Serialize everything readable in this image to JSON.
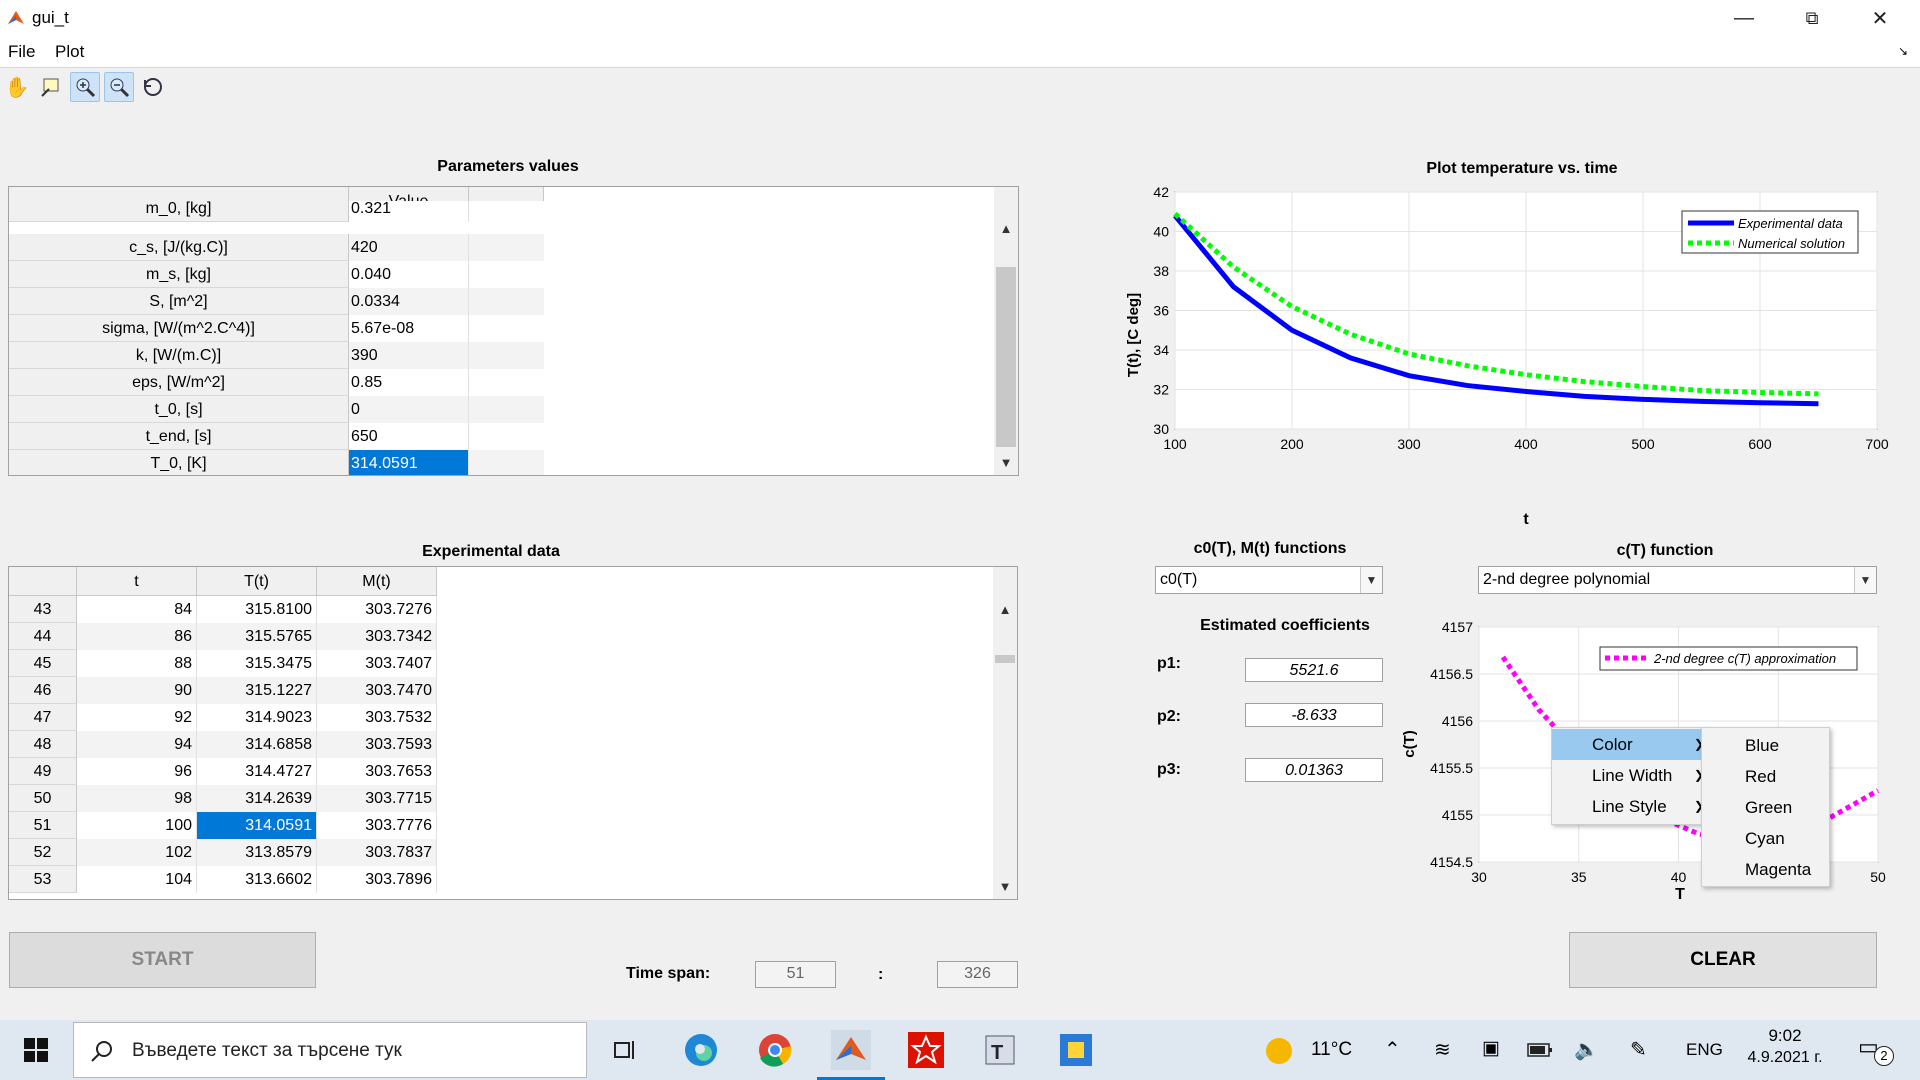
{
  "window": {
    "title": "gui_t"
  },
  "menu": [
    "File",
    "Plot"
  ],
  "params_panel": {
    "title": "Parameters values",
    "col_header": "Value",
    "rows": [
      {
        "label": "m_0, [kg]",
        "value": "0.321"
      },
      {
        "label": "c_s, [J/(kg.C)]",
        "value": "420"
      },
      {
        "label": "m_s, [kg]",
        "value": "0.040"
      },
      {
        "label": "S, [m^2]",
        "value": "0.0334"
      },
      {
        "label": "sigma, [W/(m^2.C^4)]",
        "value": "5.67e-08"
      },
      {
        "label": "k, [W/(m.C)]",
        "value": "390"
      },
      {
        "label": "eps, [W/m^2]",
        "value": "0.85"
      },
      {
        "label": "t_0, [s]",
        "value": "0"
      },
      {
        "label": "t_end, [s]",
        "value": "650"
      },
      {
        "label": "T_0, [K]",
        "value": "314.0591"
      }
    ]
  },
  "exp_panel": {
    "title": "Experimental data",
    "headers": [
      "t",
      "T(t)",
      "M(t)"
    ],
    "rows": [
      {
        "n": "43",
        "t": "84",
        "T": "315.8100",
        "M": "303.7276"
      },
      {
        "n": "44",
        "t": "86",
        "T": "315.5765",
        "M": "303.7342"
      },
      {
        "n": "45",
        "t": "88",
        "T": "315.3475",
        "M": "303.7407"
      },
      {
        "n": "46",
        "t": "90",
        "T": "315.1227",
        "M": "303.7470"
      },
      {
        "n": "47",
        "t": "92",
        "T": "314.9023",
        "M": "303.7532"
      },
      {
        "n": "48",
        "t": "94",
        "T": "314.6858",
        "M": "303.7593"
      },
      {
        "n": "49",
        "t": "96",
        "T": "314.4727",
        "M": "303.7653"
      },
      {
        "n": "50",
        "t": "98",
        "T": "314.2639",
        "M": "303.7715"
      },
      {
        "n": "51",
        "t": "100",
        "T": "314.0591",
        "M": "303.7776"
      },
      {
        "n": "52",
        "t": "102",
        "T": "313.8579",
        "M": "303.7837"
      },
      {
        "n": "53",
        "t": "104",
        "T": "313.6602",
        "M": "303.7896"
      }
    ]
  },
  "start_label": "START",
  "clear_label": "CLEAR",
  "time_span": {
    "label": "Time span:",
    "from": "51",
    "sep": ":",
    "to": "326"
  },
  "functions": {
    "c0_title": "c0(T), M(t) functions",
    "c0_value": "c0(T)",
    "cT_title": "c(T) function",
    "cT_value": "2-nd degree polynomial",
    "coef_title": "Estimated coefficients",
    "coefs": [
      {
        "label": "p1:",
        "value": "5521.6"
      },
      {
        "label": "p2:",
        "value": "-8.633"
      },
      {
        "label": "p3:",
        "value": "0.01363"
      }
    ]
  },
  "context_menu": {
    "items": [
      "Color",
      "Line Width",
      "Line Style"
    ],
    "submenu": [
      "Blue",
      "Red",
      "Green",
      "Cyan",
      "Magenta"
    ]
  },
  "colors": {
    "blue": "#0000ff",
    "green": "#00ff00",
    "magenta": "#ff00ff",
    "select": "#0078d7"
  },
  "chart_data": [
    {
      "type": "line",
      "title": "Plot temperature vs. time",
      "xlabel": "t",
      "ylabel": "T(t), [C deg]",
      "xlim": [
        100,
        700
      ],
      "ylim": [
        30,
        42
      ],
      "xticks": [
        "100",
        "200",
        "300",
        "400",
        "500",
        "600",
        "700"
      ],
      "yticks": [
        "30",
        "32",
        "34",
        "36",
        "38",
        "40",
        "42"
      ],
      "grid": true,
      "legend_position": "top-right",
      "series": [
        {
          "name": "Experimental data",
          "style": "solid",
          "color": "#0000ff",
          "x": [
            100,
            150,
            200,
            250,
            300,
            350,
            400,
            450,
            500,
            550,
            600,
            650
          ],
          "y": [
            40.8,
            37.2,
            35.0,
            33.6,
            32.7,
            32.2,
            31.9,
            31.65,
            31.5,
            31.4,
            31.33,
            31.28
          ]
        },
        {
          "name": "Numerical solution",
          "style": "dotted",
          "color": "#00ff00",
          "x": [
            100,
            150,
            200,
            250,
            300,
            350,
            400,
            450,
            500,
            550,
            600,
            650
          ],
          "y": [
            40.9,
            38.2,
            36.2,
            34.8,
            33.8,
            33.2,
            32.75,
            32.4,
            32.15,
            31.95,
            31.85,
            31.78
          ]
        }
      ]
    },
    {
      "type": "line",
      "xlabel": "T",
      "ylabel": "c(T)",
      "xlim": [
        30,
        50
      ],
      "ylim": [
        4154.5,
        4157
      ],
      "xticks": [
        "30",
        "35",
        "40",
        "45",
        "50"
      ],
      "yticks": [
        "4154.5",
        "4155",
        "4155.5",
        "4156",
        "4156.5",
        "4157"
      ],
      "grid": true,
      "legend_position": "top-right",
      "series": [
        {
          "name": "2-nd degree c(T) approximation",
          "style": "dotted",
          "color": "#ff00ff",
          "x": [
            31.2,
            33,
            35,
            37,
            39,
            41,
            43,
            45,
            47,
            49,
            50
          ],
          "y": [
            4156.68,
            4156.12,
            4155.66,
            4155.27,
            4154.98,
            4154.8,
            4154.72,
            4154.76,
            4154.9,
            4155.14,
            4155.26
          ]
        }
      ]
    }
  ],
  "taskbar": {
    "search_placeholder": "Въведете текст за търсене тук",
    "weather": "11°C",
    "lang": "ENG",
    "time": "9:02",
    "date": "4.9.2021 г.",
    "notif_count": "2"
  }
}
